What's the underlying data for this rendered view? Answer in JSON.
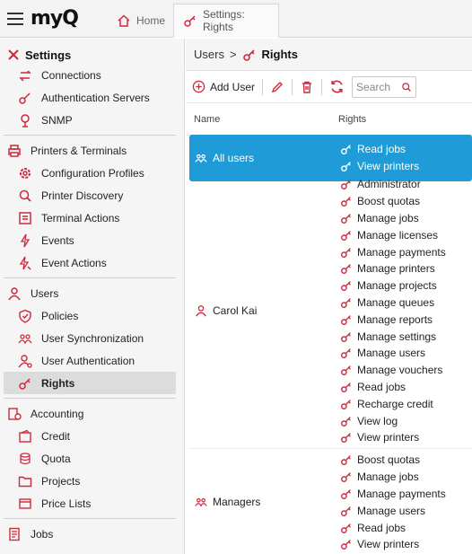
{
  "app": {
    "logo_text": "myQ"
  },
  "tabs": [
    {
      "label": "Home",
      "icon": "home-icon",
      "active": false
    },
    {
      "label": "Settings: Rights",
      "icon": "key-icon",
      "active": true
    }
  ],
  "sidebar": {
    "title": "Settings",
    "items": [
      {
        "label": "Connections",
        "icon": "connections-icon",
        "type": "child"
      },
      {
        "label": "Authentication Servers",
        "icon": "auth-server-icon",
        "type": "child"
      },
      {
        "label": "SNMP",
        "icon": "snmp-icon",
        "type": "child"
      },
      {
        "label": "Printers & Terminals",
        "icon": "printer-icon",
        "type": "group"
      },
      {
        "label": "Configuration Profiles",
        "icon": "config-gear-icon",
        "type": "child"
      },
      {
        "label": "Printer Discovery",
        "icon": "discovery-icon",
        "type": "child"
      },
      {
        "label": "Terminal Actions",
        "icon": "terminal-actions-icon",
        "type": "child"
      },
      {
        "label": "Events",
        "icon": "lightning-icon",
        "type": "child"
      },
      {
        "label": "Event Actions",
        "icon": "event-actions-icon",
        "type": "child"
      },
      {
        "label": "Users",
        "icon": "user-icon",
        "type": "group"
      },
      {
        "label": "Policies",
        "icon": "shield-icon",
        "type": "child"
      },
      {
        "label": "User Synchronization",
        "icon": "users-sync-icon",
        "type": "child"
      },
      {
        "label": "User Authentication",
        "icon": "user-auth-icon",
        "type": "child"
      },
      {
        "label": "Rights",
        "icon": "key-icon",
        "type": "child",
        "active": true
      },
      {
        "label": "Accounting",
        "icon": "accounting-icon",
        "type": "group"
      },
      {
        "label": "Credit",
        "icon": "credit-icon",
        "type": "child"
      },
      {
        "label": "Quota",
        "icon": "quota-icon",
        "type": "child"
      },
      {
        "label": "Projects",
        "icon": "folder-icon",
        "type": "child"
      },
      {
        "label": "Price Lists",
        "icon": "price-list-icon",
        "type": "child"
      },
      {
        "label": "Jobs",
        "icon": "jobs-icon",
        "type": "group"
      }
    ]
  },
  "breadcrumb": {
    "parent": "Users",
    "separator": ">",
    "current": "Rights"
  },
  "toolbar": {
    "add_user": "Add User",
    "search_placeholder": "Search"
  },
  "table": {
    "columns": [
      "Name",
      "Rights"
    ],
    "rows": [
      {
        "name": "All users",
        "icon": "group-icon",
        "selected": true,
        "rights": [
          "Read jobs",
          "View printers"
        ]
      },
      {
        "name": "Carol Kai",
        "icon": "user-icon",
        "selected": false,
        "rights": [
          "Administrator",
          "Boost quotas",
          "Manage jobs",
          "Manage licenses",
          "Manage payments",
          "Manage printers",
          "Manage projects",
          "Manage queues",
          "Manage reports",
          "Manage settings",
          "Manage users",
          "Manage vouchers",
          "Read jobs",
          "Recharge credit",
          "View log",
          "View printers"
        ]
      },
      {
        "name": "Managers",
        "icon": "group-icon",
        "selected": false,
        "rights": [
          "Boost quotas",
          "Manage jobs",
          "Manage payments",
          "Manage users",
          "Read jobs",
          "View printers"
        ]
      }
    ]
  },
  "colors": {
    "accent": "#d0283a",
    "selected": "#1f9bd7"
  }
}
